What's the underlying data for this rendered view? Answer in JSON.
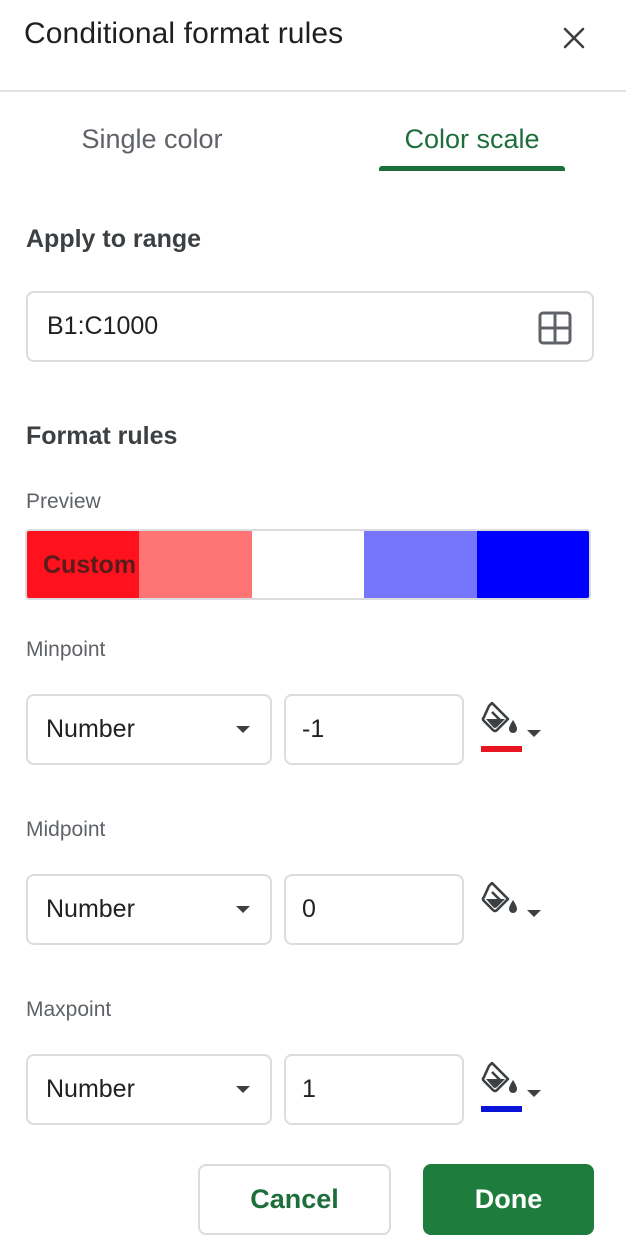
{
  "dialog": {
    "title": "Conditional format rules"
  },
  "tabs": [
    {
      "label": "Single color",
      "active": false
    },
    {
      "label": "Color scale",
      "active": true
    }
  ],
  "apply_range": {
    "label": "Apply to range",
    "value": "B1:C1000"
  },
  "format_rules": {
    "label": "Format rules",
    "preview_label": "Preview",
    "preview_text": "Custom",
    "preview_colors": [
      "#ff111d",
      "#ff7576",
      "#ffffff",
      "#7676fd",
      "#0000fd"
    ]
  },
  "points": [
    {
      "label": "Minpoint",
      "type": "Number",
      "value": "-1",
      "color": "#e8141f"
    },
    {
      "label": "Midpoint",
      "type": "Number",
      "value": "0",
      "color": "#ffffff"
    },
    {
      "label": "Maxpoint",
      "type": "Number",
      "value": "1",
      "color": "#0a14d8"
    }
  ],
  "actions": {
    "cancel_label": "Cancel",
    "done_label": "Done"
  },
  "theme": {
    "accent": "#1e6e3c",
    "primary_button": "#1e7d3c"
  }
}
